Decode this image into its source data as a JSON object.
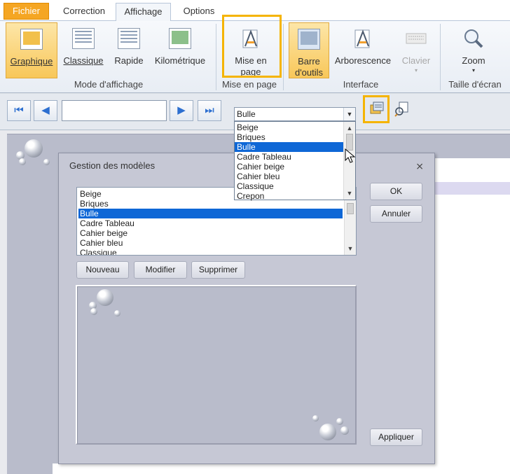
{
  "tabs": {
    "fichier": "Fichier",
    "correction": "Correction",
    "affichage": "Affichage",
    "options": "Options"
  },
  "ribbon": {
    "graphique": "Graphique",
    "classique": "Classique",
    "rapide": "Rapide",
    "kilometrique": "Kilométrique",
    "mode_label": "Mode d'affichage",
    "mise_en_page_1": "Mise en",
    "mise_en_page_2": "page",
    "mise_en_page_label": "Mise en page",
    "barre_1": "Barre",
    "barre_2": "d'outils",
    "arborescence": "Arborescence",
    "clavier": "Clavier",
    "interface_label": "Interface",
    "zoom": "Zoom",
    "taille_label": "Taille d'écran"
  },
  "toolbar": {
    "page_value": "",
    "combo_value": "Bulle",
    "dropdown_items": [
      "Beige",
      "Briques",
      "Bulle",
      "Cadre Tableau",
      "Cahier beige",
      "Cahier bleu",
      "Classique",
      "Crepon"
    ],
    "selected_index": 2
  },
  "dialog": {
    "title": "Gestion des modèles",
    "close": "⨯",
    "list_items": [
      "Beige",
      "Briques",
      "Bulle",
      "Cadre Tableau",
      "Cahier beige",
      "Cahier bleu",
      "Classique"
    ],
    "ok": "OK",
    "annuler": "Annuler",
    "nouveau": "Nouveau",
    "modifier": "Modifier",
    "supprimer": "Supprimer",
    "appliquer": "Appliquer"
  },
  "colors": {
    "accent": "#f5a623",
    "highlight": "#f5b400",
    "selection": "#0e67d6"
  },
  "icons": {
    "first": "⏮",
    "prev": "◀",
    "next": "▶",
    "last": "⏭",
    "dropdown": "▼",
    "scroll_up": "▲",
    "scroll_down": "▼"
  }
}
